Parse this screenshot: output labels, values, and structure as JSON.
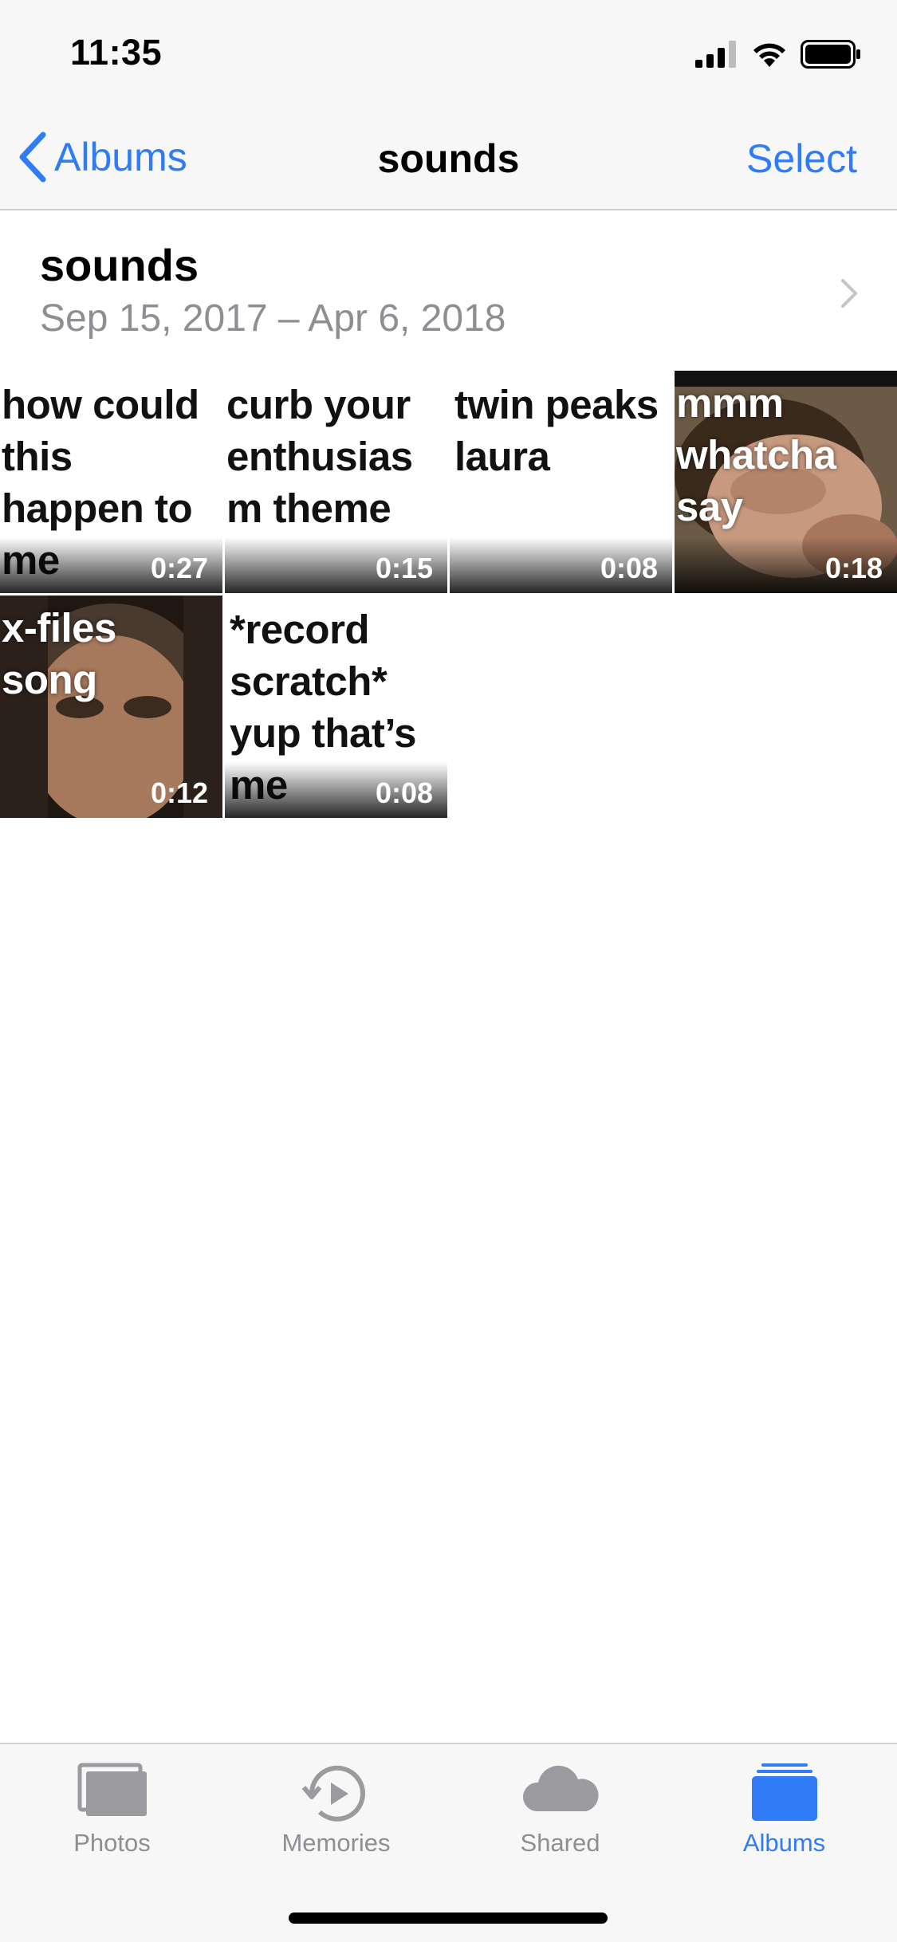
{
  "status": {
    "time": "11:35",
    "icons": [
      "signal-icon",
      "wifi-icon",
      "battery-icon"
    ]
  },
  "nav": {
    "back_label": "Albums",
    "title": "sounds",
    "select_label": "Select"
  },
  "album": {
    "title": "sounds",
    "date_range": "Sep 15, 2017 – Apr 6, 2018"
  },
  "tiles": [
    {
      "caption": "how could this happen to me",
      "duration": "0:27"
    },
    {
      "caption": "curb your enthusias m theme",
      "duration": "0:15"
    },
    {
      "caption": "twin peaks laura",
      "duration": "0:08"
    },
    {
      "caption": "mmm whatcha say",
      "duration": "0:18"
    },
    {
      "caption": "x-files song",
      "duration": "0:12"
    },
    {
      "caption": "*record scratch* yup that’s me",
      "duration": "0:08"
    }
  ],
  "tabs": [
    {
      "label": "Photos",
      "icon": "photos-icon",
      "active": false
    },
    {
      "label": "Memories",
      "icon": "memories-icon",
      "active": false
    },
    {
      "label": "Shared",
      "icon": "cloud-icon",
      "active": false
    },
    {
      "label": "Albums",
      "icon": "albums-icon",
      "active": true
    }
  ],
  "colors": {
    "accent": "#2f7cf6",
    "secondary_text": "#8e8e93",
    "bar_background": "#f7f7f7"
  }
}
